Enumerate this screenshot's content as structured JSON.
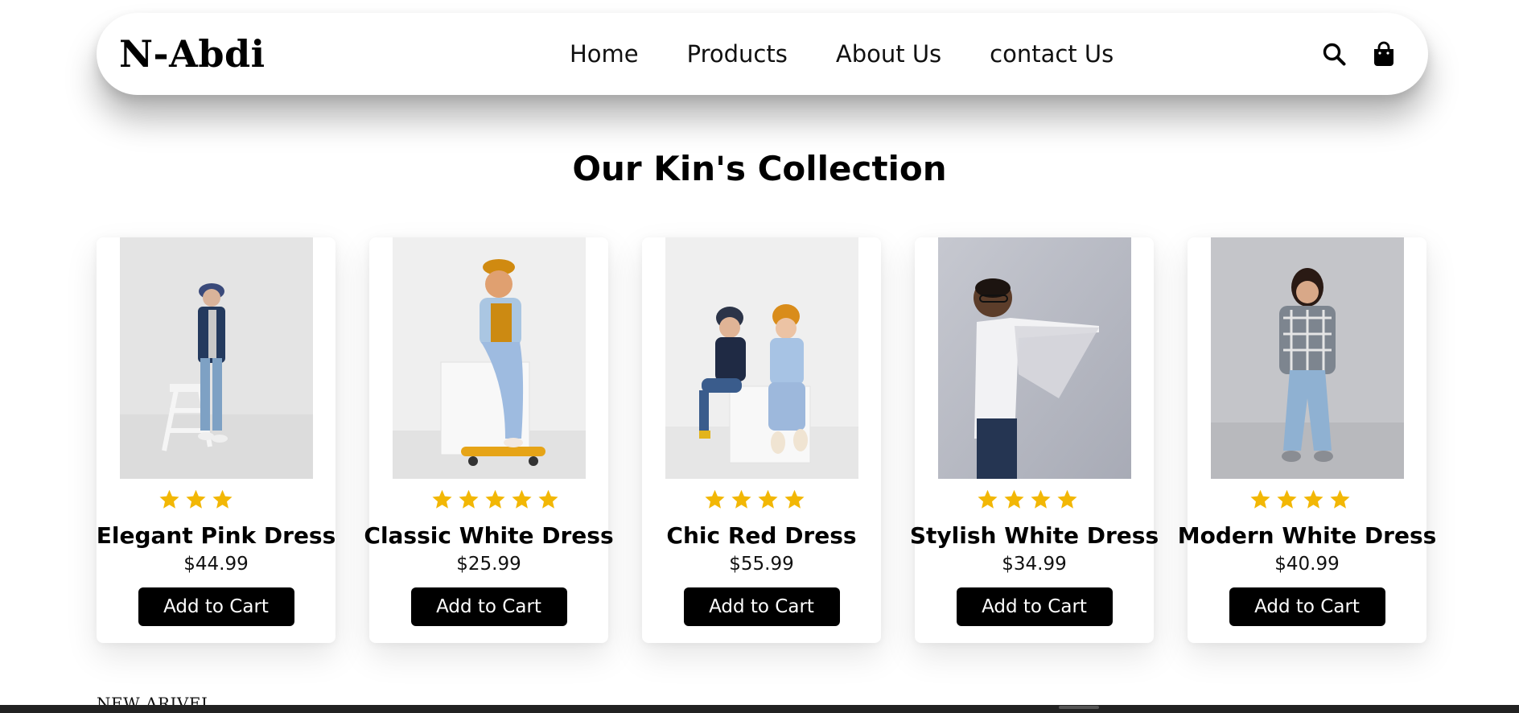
{
  "navbar": {
    "brand": "N-Abdi",
    "links": [
      "Home",
      "Products",
      "About Us",
      "contact Us"
    ],
    "icons": {
      "search": "search-icon",
      "bag": "shopping-bag-icon"
    }
  },
  "collection": {
    "title": "Our Kin's Collection",
    "products": [
      {
        "name": "Elegant Pink Dress",
        "price": "$44.99",
        "rating": 3,
        "button": "Add to Cart"
      },
      {
        "name": "Classic White Dress",
        "price": "$25.99",
        "rating": 5,
        "button": "Add to Cart"
      },
      {
        "name": "Chic Red Dress",
        "price": "$55.99",
        "rating": 4,
        "button": "Add to Cart"
      },
      {
        "name": "Stylish White Dress",
        "price": "$34.99",
        "rating": 4,
        "button": "Add to Cart"
      },
      {
        "name": "Modern White Dress",
        "price": "$40.99",
        "rating": 4,
        "button": "Add to Cart"
      }
    ]
  },
  "next_section": {
    "title": "NEW ARIVEL"
  },
  "colors": {
    "star": "#f2b705",
    "button_bg": "#000000",
    "button_text": "#ffffff"
  }
}
